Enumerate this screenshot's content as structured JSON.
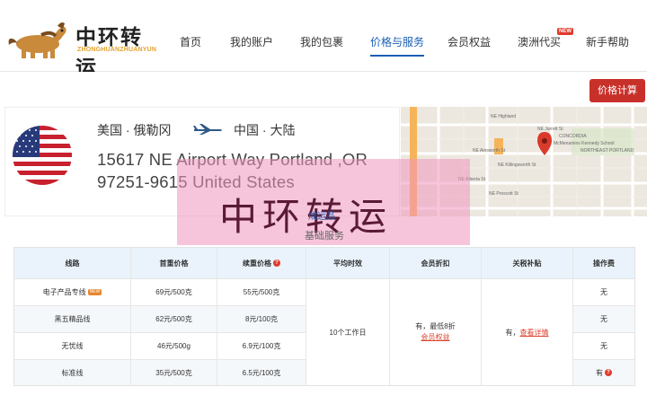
{
  "header": {
    "logo_cn": "中环转运",
    "logo_en": "ZHONGHUANZHUANYUN",
    "nav": [
      {
        "label": "首页"
      },
      {
        "label": "我的账户"
      },
      {
        "label": "我的包裹"
      },
      {
        "label": "价格与服务"
      },
      {
        "label": "会员权益"
      },
      {
        "label": "澳洲代买",
        "badge": "NEW"
      },
      {
        "label": "新手帮助"
      }
    ]
  },
  "calc_button": "价格计算",
  "route": {
    "origin": "美国 · 俄勒冈",
    "destination": "中国 · 大陆",
    "address_line1": "15617 NE Airport Way Portland ,OR",
    "address_line2": "97251-9615 United States"
  },
  "map": {
    "labels": [
      "NE Ainsworth St",
      "NE Killingsworth St",
      "NE Alberta St",
      "NE Prescott St",
      "NE Jarrett St",
      "McMenamins Kennedy School",
      "CONCORDIA",
      "NORTHEAST PORTLAND",
      "NE 15th Ave",
      "NE 33rd Ave",
      "NE 42nd Ave",
      "NE Highland"
    ]
  },
  "watermark": "中环转运",
  "service_tab": "成运品",
  "service_basic": "基础服务",
  "table": {
    "headers": [
      "线路",
      "首重价格",
      "续重价格",
      "平均时效",
      "会员折扣",
      "关税补贴",
      "操作费"
    ],
    "rows": [
      {
        "line": "电子产品专线",
        "badge": "NEW",
        "first": "69元/500克",
        "cont": "55元/500克",
        "fee": "无"
      },
      {
        "line": "黑五精品线",
        "first": "62元/500克",
        "cont": "8元/100克",
        "fee": "无"
      },
      {
        "line": "无忧线",
        "first": "46元/500g",
        "cont": "6.9元/100克",
        "fee": "无"
      },
      {
        "line": "标准线",
        "first": "35元/500克",
        "cont": "6.5元/100克",
        "fee": "有"
      }
    ],
    "avg_time": "10个工作日",
    "discount_text": "有，最低8折",
    "discount_link": "会员权益",
    "tax_text": "有，",
    "tax_link": "查看详情",
    "colors": {
      "header_bg": "#eaf3fb",
      "accent_red": "#c8302a",
      "link_blue": "#1a5fb4"
    }
  }
}
